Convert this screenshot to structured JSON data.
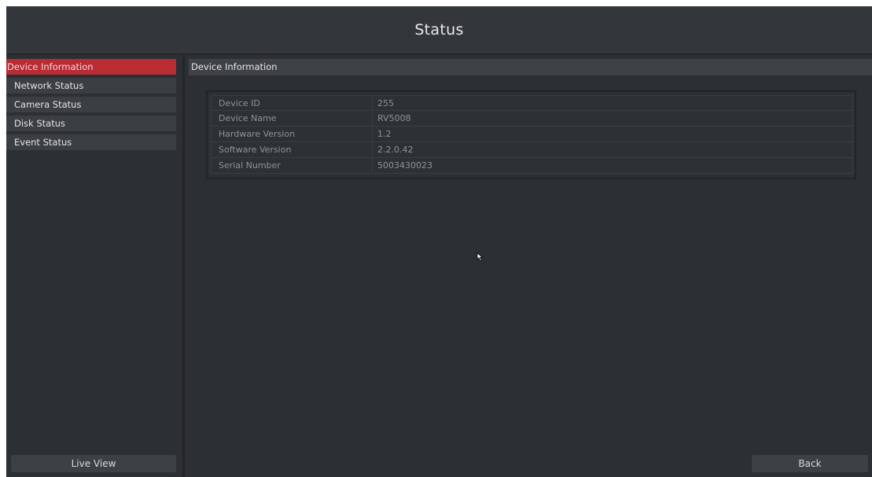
{
  "header": {
    "title": "Status"
  },
  "sidebar": {
    "items": [
      {
        "label": "Device Information",
        "active": true
      },
      {
        "label": "Network Status",
        "active": false
      },
      {
        "label": "Camera Status",
        "active": false
      },
      {
        "label": "Disk Status",
        "active": false
      },
      {
        "label": "Event Status",
        "active": false
      }
    ],
    "live_view_label": "Live View"
  },
  "main": {
    "section_title": "Device Information",
    "rows": [
      {
        "label": "Device ID",
        "value": "255"
      },
      {
        "label": "Device Name",
        "value": "RV5008"
      },
      {
        "label": "Hardware Version",
        "value": "1.2"
      },
      {
        "label": "Software Version",
        "value": "2.2.0.42"
      },
      {
        "label": "Serial Number",
        "value": "5003430023"
      }
    ],
    "back_label": "Back"
  },
  "colors": {
    "accent_active": "#b92c33",
    "background": "#2c2f33",
    "header_bg": "#33363a",
    "button_bg": "#3d4045"
  },
  "icons": {
    "cursor": "mouse-pointer-icon"
  }
}
